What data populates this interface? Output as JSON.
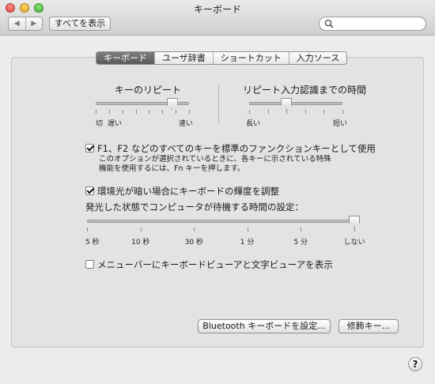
{
  "window": {
    "title": "キーボード"
  },
  "toolbar": {
    "back_icon": "◀",
    "forward_icon": "▶",
    "show_all_label": "すべてを表示",
    "search_placeholder": "",
    "search_value": ""
  },
  "tabs": [
    {
      "label": "キーボード",
      "active": true
    },
    {
      "label": "ユーザ辞書",
      "active": false
    },
    {
      "label": "ショートカット",
      "active": false
    },
    {
      "label": "入力ソース",
      "active": false
    }
  ],
  "key_repeat": {
    "title": "キーのリピート",
    "labels": {
      "off": "切",
      "slow": "遅い",
      "fast": "速い"
    },
    "value_fraction": 0.82,
    "tick_count": 8
  },
  "delay_until_repeat": {
    "title": "リピート入力認識までの時間",
    "labels": {
      "long": "長い",
      "short": "短い"
    },
    "value_fraction": 0.4,
    "tick_count": 6
  },
  "fn_keys": {
    "checked": true,
    "label": "F1、F2 などのすべてのキーを標準のファンクションキーとして使用",
    "note_line1": "このオプションが選択されているときに、各キーに示されている特殊",
    "note_line2": "機能を使用するには、Fn キーを押します。"
  },
  "backlight": {
    "checked": true,
    "label": "環境光が暗い場合にキーボードの輝度を調整"
  },
  "idle": {
    "title": "発光した状態でコンピュータが待機する時間の設定：",
    "value_fraction": 1.0,
    "labels": [
      "5 秒",
      "10 秒",
      "30 秒",
      "1 分",
      "5 分",
      "しない"
    ]
  },
  "viewer": {
    "checked": false,
    "label": "メニューバーにキーボードビューアと文字ビューアを表示"
  },
  "buttons": {
    "bluetooth": "Bluetooth キーボードを設定...",
    "modifier": "修飾キー..."
  },
  "help_label": "?"
}
